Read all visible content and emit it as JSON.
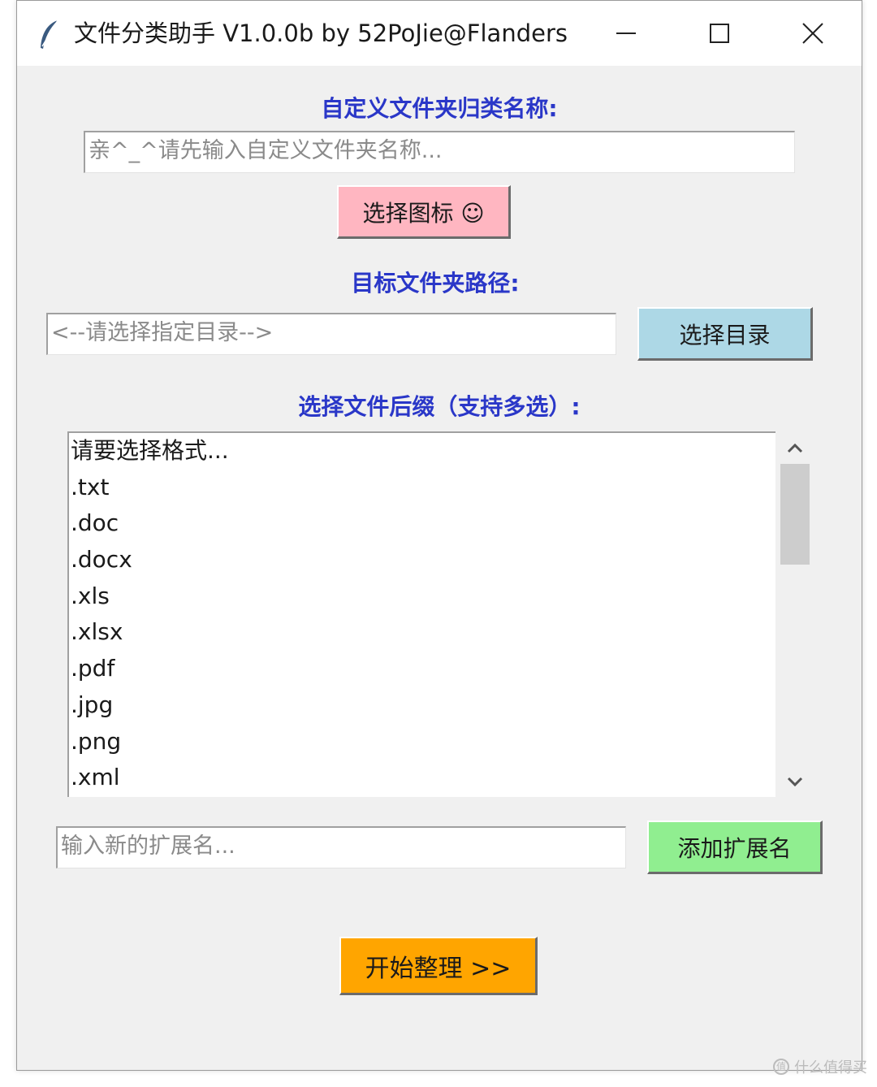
{
  "window": {
    "title": "文件分类助手 V1.0.0b by 52PoJie@Flanders",
    "icon": "feather-icon"
  },
  "folder_name": {
    "label": "自定义文件夹归类名称:",
    "placeholder": "亲^_^请先输入自定义文件夹名称..."
  },
  "icon_button": {
    "label": "选择图标 ☺",
    "color": "#ffb6c1"
  },
  "target_path": {
    "label": "目标文件夹路径:",
    "placeholder": "<--请选择指定目录-->",
    "button_label": "选择目录",
    "button_color": "#add8e6"
  },
  "suffix": {
    "label": "选择文件后缀（支持多选）:",
    "items": [
      "请要选择格式...",
      ".txt",
      ".doc",
      ".docx",
      ".xls",
      ".xlsx",
      ".pdf",
      ".jpg",
      ".png",
      ".xml"
    ]
  },
  "new_ext": {
    "placeholder": "输入新的扩展名...",
    "button_label": "添加扩展名",
    "button_color": "#90ee90"
  },
  "start_button": {
    "label": "开始整理 >>",
    "color": "#ffa500"
  },
  "watermark": {
    "text": "什么值得买",
    "icon": "值"
  },
  "colors": {
    "label_text": "#2a37c8",
    "window_bg": "#f0f0f0"
  }
}
